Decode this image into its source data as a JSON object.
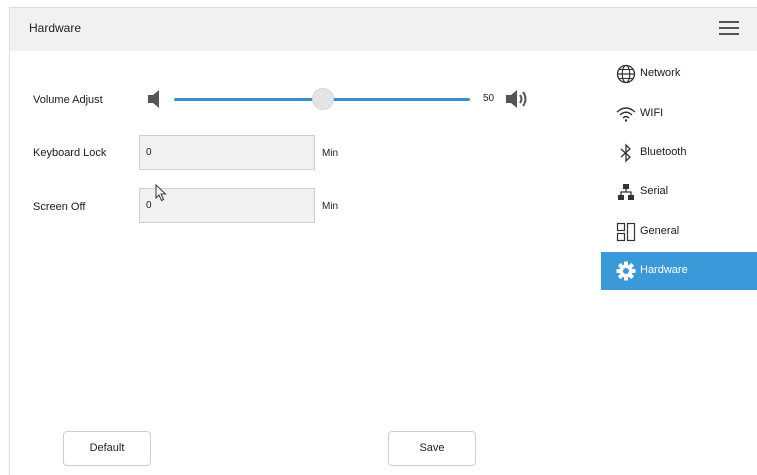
{
  "header": {
    "title": "Hardware",
    "menu_icon": "hamburger-menu-icon"
  },
  "volume": {
    "label": "Volume Adjust",
    "value": "50",
    "level": 50,
    "icon_low": "speaker-low-icon",
    "icon_high": "speaker-high-icon"
  },
  "keyboard_lock": {
    "label": "Keyboard Lock",
    "value": "0",
    "unit": "Min"
  },
  "screen_off": {
    "label": "Screen Off",
    "value": "0",
    "unit": "Min"
  },
  "sidebar": {
    "items": [
      {
        "label": "Network",
        "icon": "globe-icon",
        "active": false
      },
      {
        "label": "WIFI",
        "icon": "wifi-icon",
        "active": false
      },
      {
        "label": "Bluetooth",
        "icon": "bluetooth-icon",
        "active": false
      },
      {
        "label": "Serial",
        "icon": "network-tree-icon",
        "active": false
      },
      {
        "label": "General",
        "icon": "grid-icon",
        "active": false
      },
      {
        "label": "Hardware",
        "icon": "gear-icon",
        "active": true
      }
    ]
  },
  "buttons": {
    "default_label": "Default",
    "save_label": "Save"
  },
  "colors": {
    "accent": "#3a9ad9",
    "header_bg": "#f1f1f1",
    "slider": "#3a8fd1"
  }
}
